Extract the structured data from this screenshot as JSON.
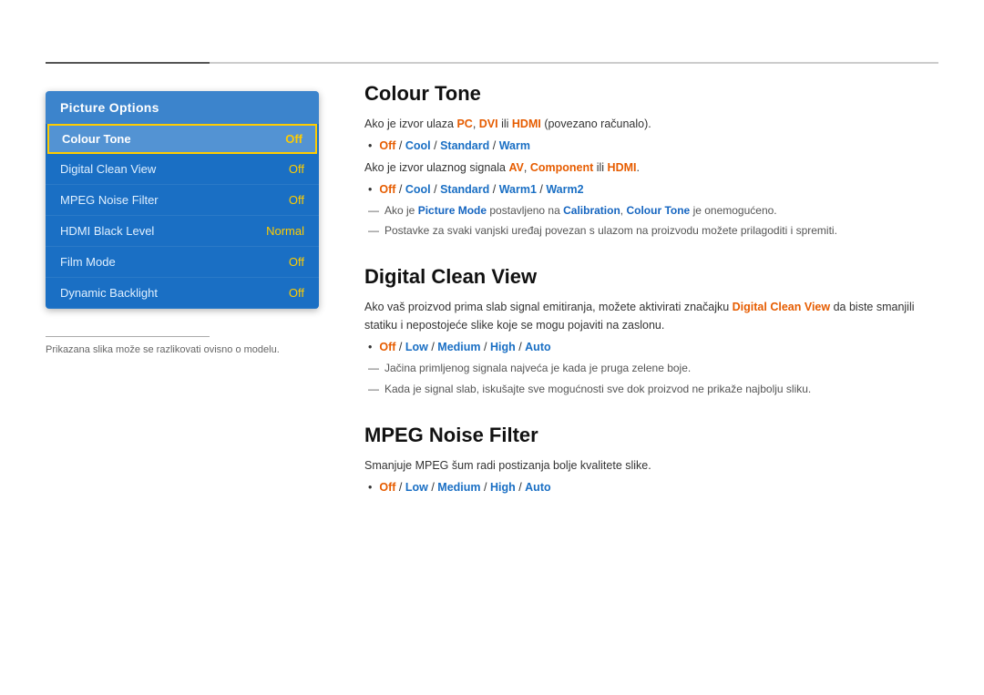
{
  "topLine": {},
  "leftPanel": {
    "title": "Picture Options",
    "menuItems": [
      {
        "label": "Colour Tone",
        "value": "Off",
        "active": true
      },
      {
        "label": "Digital Clean View",
        "value": "Off",
        "active": false
      },
      {
        "label": "MPEG Noise Filter",
        "value": "Off",
        "active": false
      },
      {
        "label": "HDMI Black Level",
        "value": "Normal",
        "active": false
      },
      {
        "label": "Film Mode",
        "value": "Off",
        "active": false
      },
      {
        "label": "Dynamic Backlight",
        "value": "Off",
        "active": false
      }
    ],
    "footnote": "Prikazana slika može se razlikovati ovisno o modelu."
  },
  "sections": [
    {
      "id": "colour-tone",
      "title": "Colour Tone",
      "paragraphs": [
        "Ako je izvor ulaza PC, DVI ili HDMI (povezano računalo).",
        "Ako je izvor ulaznog signala AV, Component ili HDMI."
      ],
      "options1": {
        "prefix": "Off",
        "items": [
          "Off",
          "Cool",
          "Standard",
          "Warm"
        ]
      },
      "options2": {
        "prefix": "Off",
        "items": [
          "Off",
          "Cool",
          "Standard",
          "Warm1",
          "Warm2"
        ]
      },
      "notes": [
        "Ako je Picture Mode postavljeno na Calibration, Colour Tone je onemogućeno.",
        "Postavke za svaki vanjski uređaj povezan s ulazom na proizvodu možete prilagoditi i spremiti."
      ]
    },
    {
      "id": "digital-clean-view",
      "title": "Digital Clean View",
      "paragraphs": [
        "Ako vaš proizvod prima slab signal emitiranja, možete aktivirati značajku Digital Clean View da biste smanjili statiku i nepostojeće slike koje se mogu pojaviti na zaslonu."
      ],
      "options1": {
        "items": [
          "Off",
          "Low",
          "Medium",
          "High",
          "Auto"
        ]
      },
      "notes": [
        "Jačina primljenog signala najveća je kada je pruga zelene boje.",
        "Kada je signal slab, iskušajte sve mogućnosti sve dok proizvod ne prikaže najbolju sliku."
      ]
    },
    {
      "id": "mpeg-noise-filter",
      "title": "MPEG Noise Filter",
      "paragraphs": [
        "Smanjuje MPEG šum radi postizanja bolje kvalitete slike."
      ],
      "options1": {
        "items": [
          "Off",
          "Low",
          "Medium",
          "High",
          "Auto"
        ]
      },
      "notes": []
    }
  ]
}
